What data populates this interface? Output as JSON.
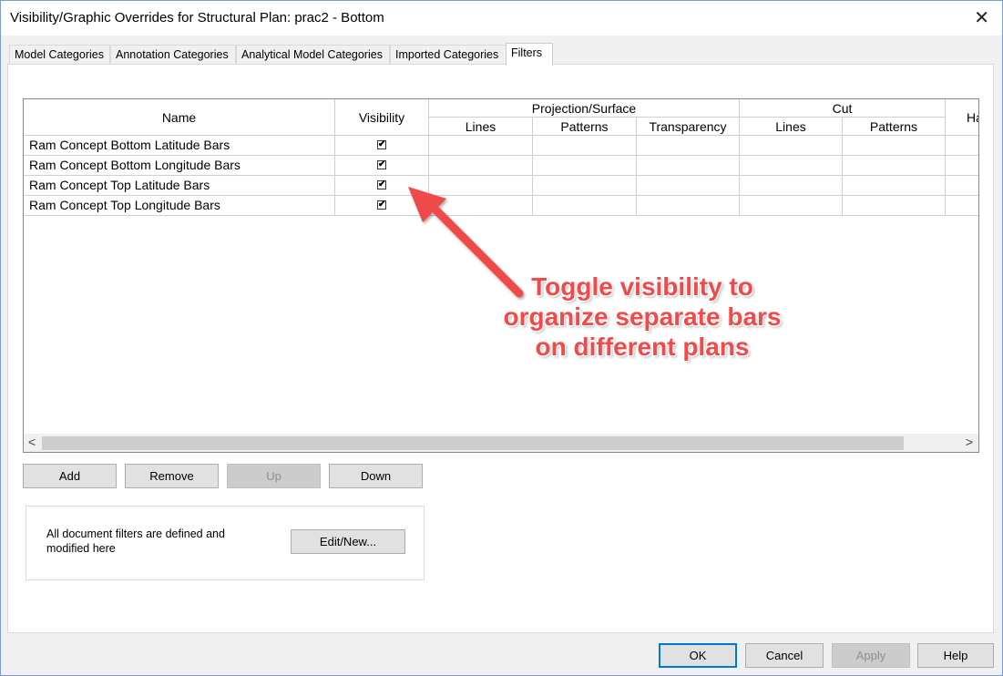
{
  "window": {
    "title": "Visibility/Graphic Overrides for Structural Plan: prac2 - Bottom"
  },
  "tabs": [
    {
      "label": "Model Categories"
    },
    {
      "label": "Annotation Categories"
    },
    {
      "label": "Analytical Model Categories"
    },
    {
      "label": "Imported Categories"
    },
    {
      "label": "Filters"
    }
  ],
  "grid": {
    "headers": {
      "name": "Name",
      "visibility": "Visibility",
      "projection": "Projection/Surface",
      "proj_lines": "Lines",
      "proj_patterns": "Patterns",
      "proj_transparency": "Transparency",
      "cut": "Cut",
      "cut_lines": "Lines",
      "cut_patterns": "Patterns",
      "halftone": "Ha"
    },
    "rows": [
      {
        "name": "Ram Concept Bottom Latitude Bars",
        "visible": "✔"
      },
      {
        "name": "Ram Concept Bottom Longitude Bars",
        "visible": "✔"
      },
      {
        "name": "Ram Concept Top Latitude Bars",
        "visible": "✔"
      },
      {
        "name": "Ram Concept Top Longitude Bars",
        "visible": "✔"
      }
    ]
  },
  "buttons": {
    "add": "Add",
    "remove": "Remove",
    "up": "Up",
    "down": "Down",
    "edit_new": "Edit/New...",
    "ok": "OK",
    "cancel": "Cancel",
    "apply": "Apply",
    "help": "Help"
  },
  "info": {
    "text": "All document filters are defined and modified here"
  },
  "annotation": {
    "line1": "Toggle visibility to",
    "line2": "organize separate bars",
    "line3": "on different plans",
    "color": "#f04a4a"
  },
  "icons": {
    "close": "close-icon",
    "scroll_left": "chevron-left-icon",
    "scroll_right": "chevron-right-icon"
  }
}
